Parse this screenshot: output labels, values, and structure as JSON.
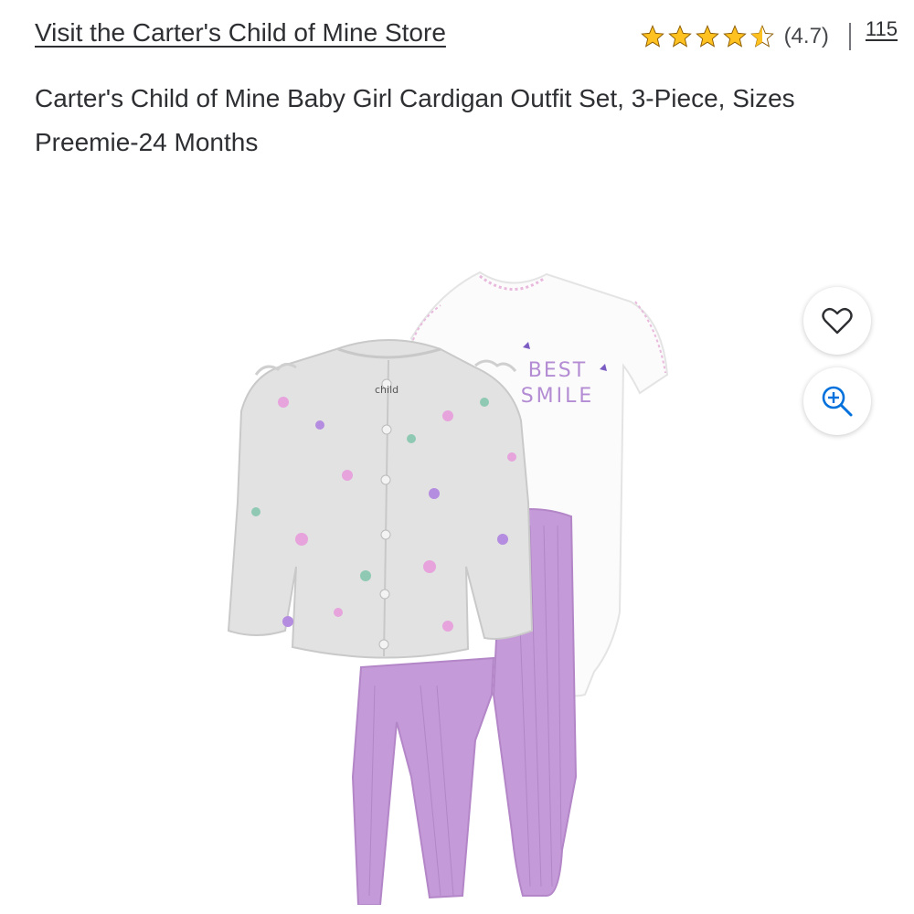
{
  "store": {
    "link_label": "Visit the Carter's Child of Mine Store"
  },
  "rating": {
    "stars": 4.5,
    "star_color": "#ffc220",
    "value_text": "(4.7)",
    "review_count": "115"
  },
  "product": {
    "title": "Carter's Child of Mine Baby Girl Cardigan Outfit Set, 3-Piece, Sizes Preemie-24 Months"
  },
  "image": {
    "bodysuit_text_line1": "BEST",
    "bodysuit_text_line2": "SMILE",
    "cardigan_label": "child"
  },
  "actions": {
    "favorite_icon": "heart-icon",
    "zoom_icon": "zoom-in-icon",
    "icon_color": "#0071dc"
  }
}
